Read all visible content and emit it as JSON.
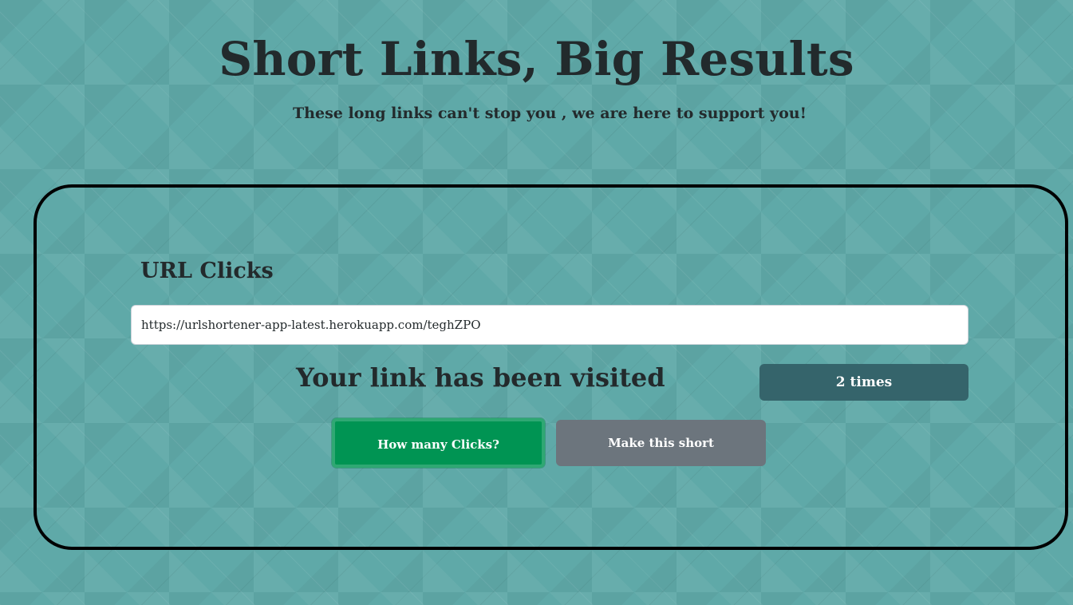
{
  "header": {
    "title": "Short Links, Big Results",
    "subtitle": "These long links can't stop you , we are here to support you!"
  },
  "clicks_form": {
    "heading": "URL Clicks",
    "url_value": "https://urlshortener-app-latest.herokuapp.com/teghZPO",
    "result_text": "Your link has been visited",
    "count_text": "2 times",
    "primary_button": "How many Clicks?",
    "secondary_button": "Make this short"
  },
  "colors": {
    "background": "#5fa9a8",
    "text": "#232a2c",
    "badge": "#35646b",
    "primary_button": "#009453",
    "secondary_button": "#6c757d",
    "card_border": "#000000"
  }
}
